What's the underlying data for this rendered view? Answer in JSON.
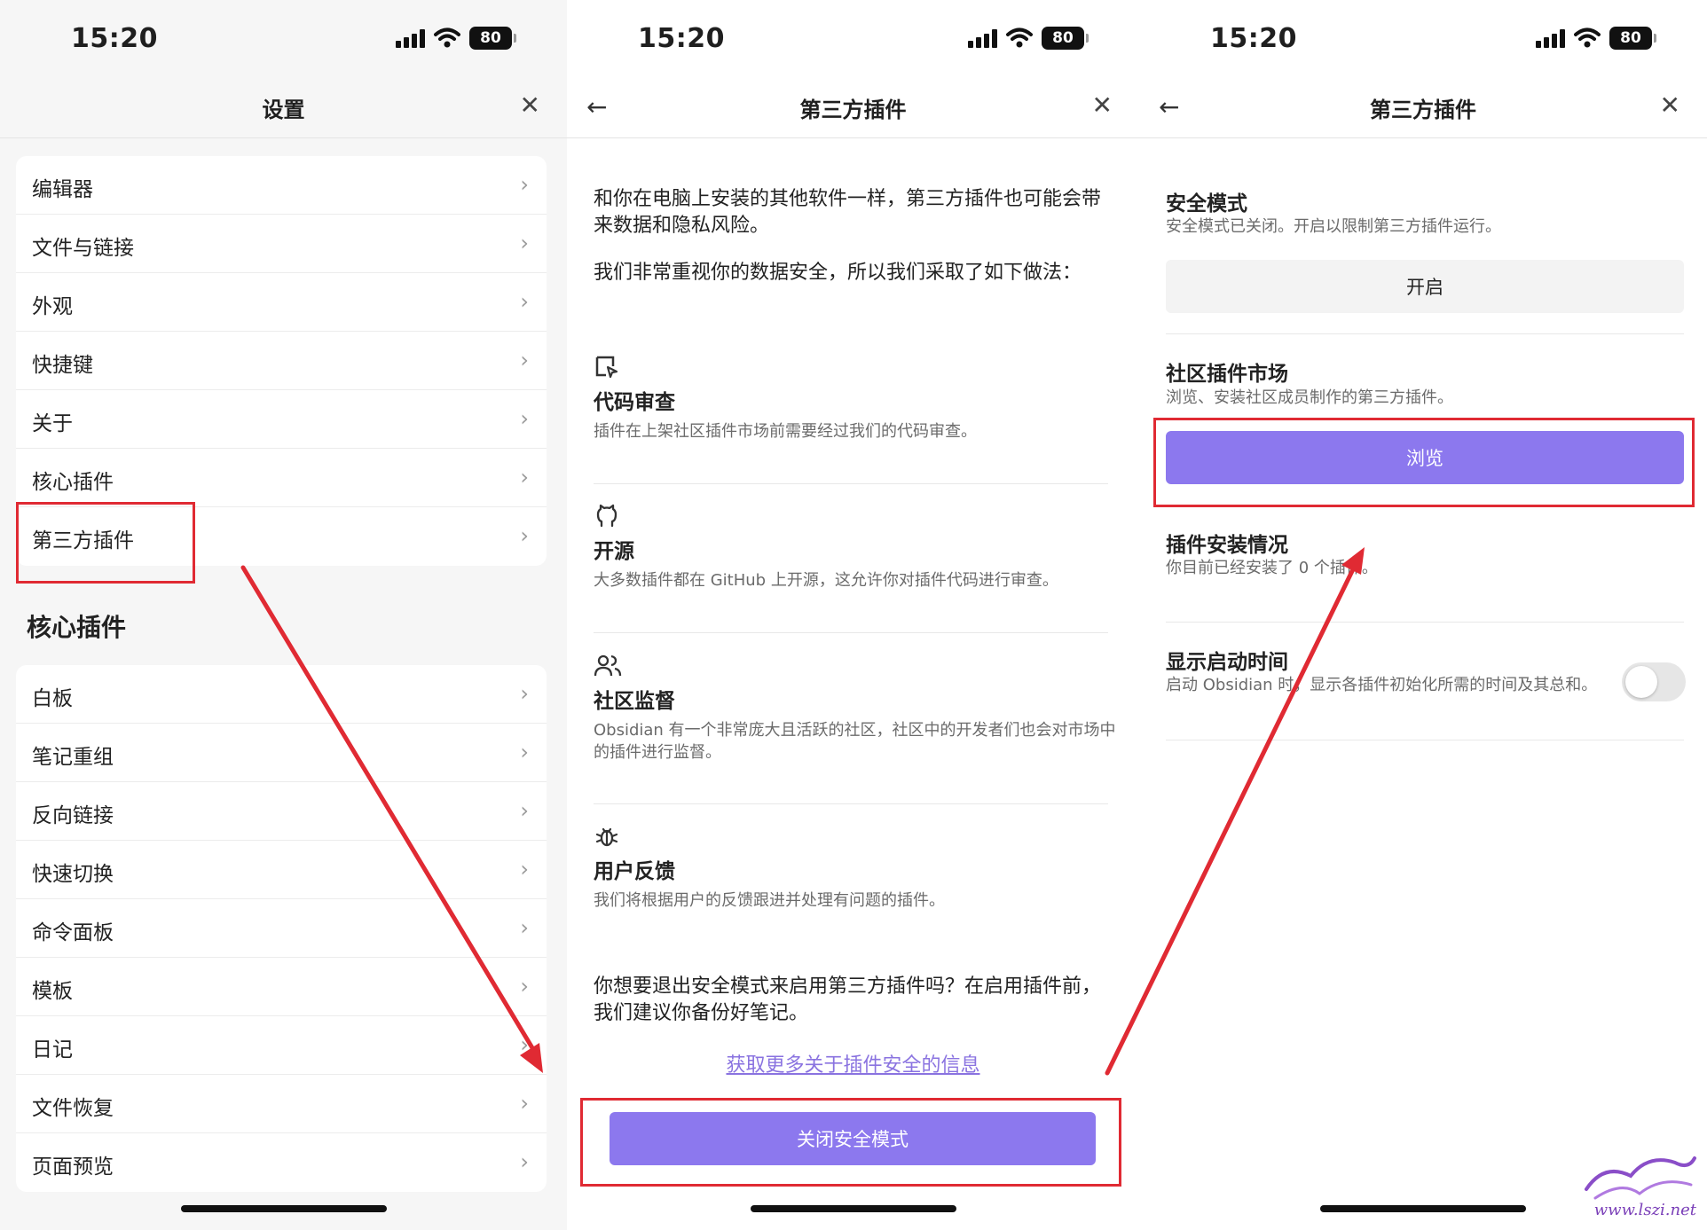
{
  "status_bar": {
    "time": "15:20",
    "battery": "80"
  },
  "screen1": {
    "title": "设置",
    "top_group": [
      "编辑器",
      "文件与链接",
      "外观",
      "快捷键",
      "关于",
      "核心插件",
      "第三方插件"
    ],
    "section_title": "核心插件",
    "core_group": [
      "白板",
      "笔记重组",
      "反向链接",
      "快速切换",
      "命令面板",
      "模板",
      "日记",
      "文件恢复",
      "页面预览"
    ]
  },
  "screen2": {
    "title": "第三方插件",
    "intro1": "和你在电脑上安装的其他软件一样，第三方插件也可能会带来数据和隐私风险。",
    "intro2": "我们非常重视你的数据安全，所以我们采取了如下做法：",
    "features": [
      {
        "icon": "code-review-icon",
        "title": "代码审查",
        "desc": "插件在上架社区插件市场前需要经过我们的代码审查。"
      },
      {
        "icon": "github-icon",
        "title": "开源",
        "desc": "大多数插件都在 GitHub 上开源，这允许你对插件代码进行审查。"
      },
      {
        "icon": "users-icon",
        "title": "社区监督",
        "desc": "Obsidian 有一个非常庞大且活跃的社区，社区中的开发者们也会对市场中的插件进行监督。"
      },
      {
        "icon": "bug-icon",
        "title": "用户反馈",
        "desc": "我们将根据用户的反馈跟进并处理有问题的插件。"
      }
    ],
    "question": "你想要退出安全模式来启用第三方插件吗？在启用插件前，我们建议你备份好笔记。",
    "link": "获取更多关于插件安全的信息",
    "button": "关闭安全模式"
  },
  "screen3": {
    "title": "第三方插件",
    "safe_mode": {
      "title": "安全模式",
      "desc": "安全模式已关闭。开启以限制第三方插件运行。",
      "button": "开启"
    },
    "market": {
      "title": "社区插件市场",
      "desc": "浏览、安装社区成员制作的第三方插件。",
      "button": "浏览"
    },
    "installed": {
      "title": "插件安装情况",
      "desc": "你目前已经安装了 0 个插件。"
    },
    "startup_time": {
      "title": "显示启动时间",
      "desc": "启动 Obsidian 时，显示各插件初始化所需的时间及其总和。",
      "enabled": false
    }
  },
  "watermark": "www.lszi.net",
  "colors": {
    "accent": "#8c78ee",
    "highlight": "#e02a33",
    "link": "#8a73e0"
  }
}
